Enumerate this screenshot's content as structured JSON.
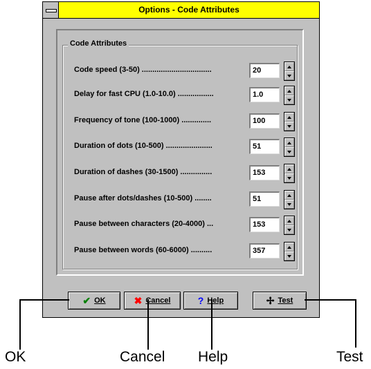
{
  "window": {
    "title": "Options - Code Attributes",
    "titlebar_color": "#ffff00",
    "background_color": "#c0c0c0"
  },
  "group": {
    "label": "Code Attributes"
  },
  "rows": [
    {
      "label": "Code speed (3-50) .................................",
      "value": "20"
    },
    {
      "label": "Delay for fast CPU (1.0-10.0) .................",
      "value": "1.0"
    },
    {
      "label": "Frequency of tone (100-1000) ..............",
      "value": "100"
    },
    {
      "label": "Duration of dots (10-500) ......................",
      "value": "51"
    },
    {
      "label": "Duration of dashes (30-1500) ...............",
      "value": "153"
    },
    {
      "label": "Pause after dots/dashes (10-500) ........",
      "value": "51"
    },
    {
      "label": "Pause between characters (20-4000) ...",
      "value": "153"
    },
    {
      "label": "Pause between words (60-6000) ..........",
      "value": "357"
    }
  ],
  "buttons": {
    "ok": {
      "label": "OK",
      "icon": "checkmark-icon",
      "glyph": "✔",
      "color": "#008000"
    },
    "cancel": {
      "label": "Cancel",
      "icon": "x-icon",
      "glyph": "✖",
      "color": "#ff0000"
    },
    "help": {
      "label": "Help",
      "icon": "question-icon",
      "glyph": "?",
      "color": "#0000ff"
    },
    "test": {
      "label": "Test",
      "icon": "test-icon",
      "glyph": "✢",
      "color": "#000000"
    }
  },
  "callouts": {
    "ok": "OK",
    "cancel": "Cancel",
    "help": "Help",
    "test": "Test"
  }
}
